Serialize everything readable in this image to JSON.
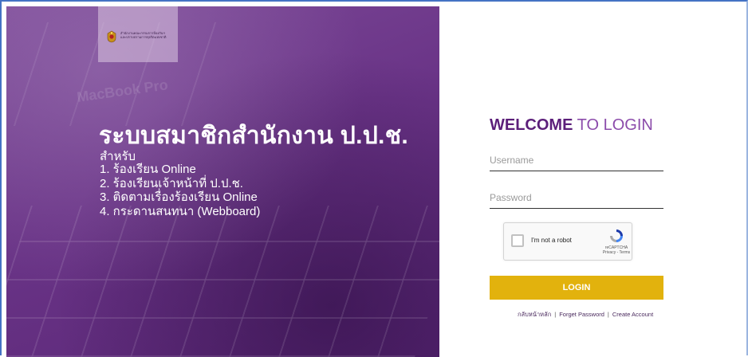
{
  "left_panel": {
    "logo_text_line1": "สำนักงานคณะกรรมการป้องกันฯ",
    "logo_text_line2": "และปราบปรามการทุจริตแห่งชาติ",
    "background_watermark": "MacBook Pro",
    "title": "ระบบสมาชิกสำนักงาน ป.ป.ช.",
    "for_label": "สำหรับ",
    "items": [
      "1. ร้องเรียน Online",
      "2. ร้องเรียนเจ้าหน้าที่ ป.ป.ช.",
      "3. ติดตามเรื่องร้องเรียน Online",
      "4. กระดานสนทนา (Webboard)"
    ]
  },
  "login_form": {
    "welcome_bold": "WELCOME",
    "welcome_rest": " TO LOGIN",
    "username_placeholder": "Username",
    "password_placeholder": "Password",
    "captcha_label": "I'm not a robot",
    "captcha_brand": "reCAPTCHA",
    "captcha_links": "Privacy - Terms",
    "login_button": "LOGIN",
    "link_home": "กลับหน้าหลัก",
    "link_forgot": "Forget Password",
    "link_create": "Create Account",
    "separator": "|"
  },
  "colors": {
    "brand_purple": "#6a3487",
    "welcome_purple": "#5c1f7a",
    "login_gold": "#e2b20d"
  }
}
